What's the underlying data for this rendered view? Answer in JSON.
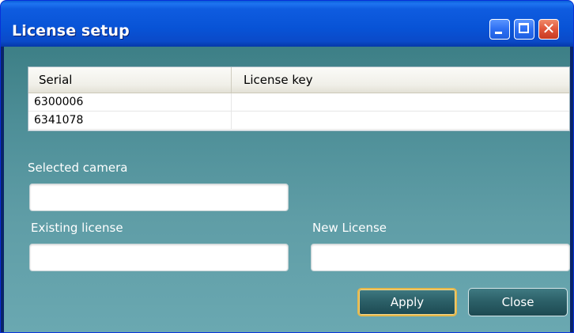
{
  "window": {
    "title": "License setup"
  },
  "titlebar_buttons": [
    "minimize-icon",
    "maximize-icon",
    "close-icon"
  ],
  "table": {
    "columns": [
      "Serial",
      "License key"
    ],
    "rows": [
      {
        "serial": "6300006",
        "license_key": ""
      },
      {
        "serial": "6341078",
        "license_key": ""
      }
    ]
  },
  "form": {
    "selected_camera_label": "Selected camera",
    "selected_camera_value": "",
    "existing_license_label": "Existing license",
    "existing_license_value": "",
    "new_license_label": "New License",
    "new_license_value": ""
  },
  "buttons": {
    "apply": "Apply",
    "close": "Close"
  },
  "colors": {
    "titlebar": "#0853d6",
    "panel": "#5a9aa3",
    "apply_focus_border": "#e6b84a"
  }
}
